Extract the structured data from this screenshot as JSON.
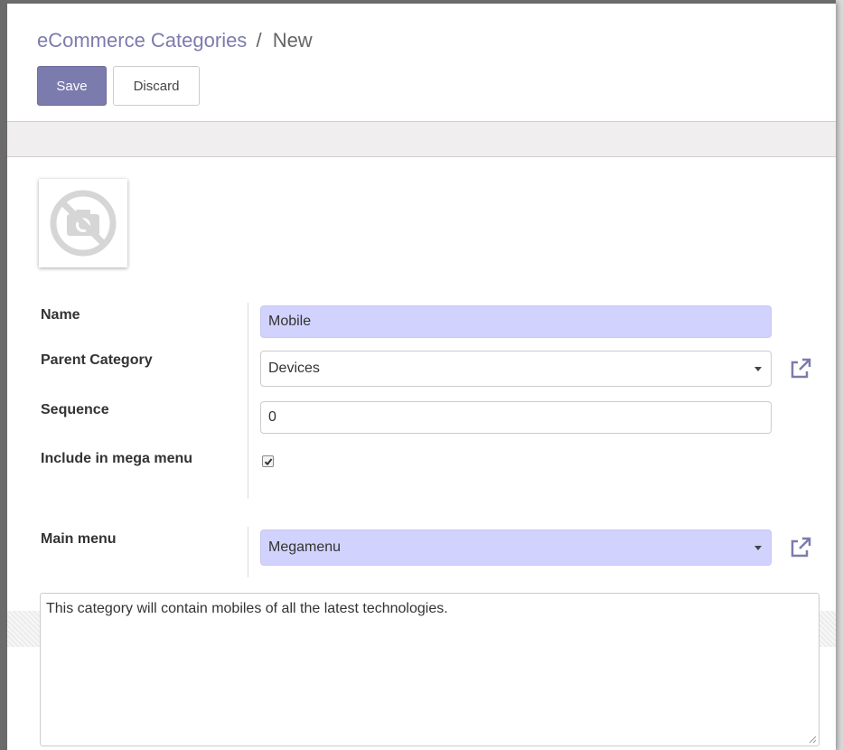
{
  "breadcrumb": {
    "parent": "eCommerce Categories",
    "separator": "/",
    "current": "New"
  },
  "toolbar": {
    "save_label": "Save",
    "discard_label": "Discard"
  },
  "form": {
    "image_icon": "no-camera-placeholder-icon",
    "name": {
      "label": "Name",
      "value": "Mobile"
    },
    "parent_category": {
      "label": "Parent Category",
      "value": "Devices"
    },
    "sequence": {
      "label": "Sequence",
      "value": "0"
    },
    "include_mega_menu": {
      "label": "Include in mega menu",
      "checked": true
    },
    "main_menu": {
      "label": "Main menu",
      "value": "Megamenu"
    },
    "description": "This category will contain mobiles of all the latest technologies."
  },
  "colors": {
    "primary": "#7c7bad",
    "required_field": "#d2d2ff",
    "external_link_icon": "#7c7bad"
  }
}
